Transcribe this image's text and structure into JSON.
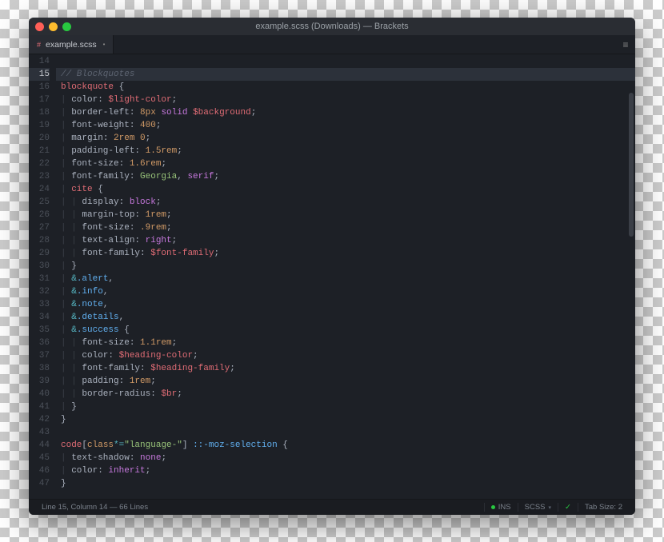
{
  "window": {
    "title": "example.scss (Downloads) — Brackets"
  },
  "tab": {
    "icon": "#",
    "label": "example.scss",
    "dirty": "•"
  },
  "menu_btn": "≡",
  "lines_start": 14,
  "lines_end": 47,
  "active_line": 15,
  "code": [
    {
      "n": 14,
      "h": ""
    },
    {
      "n": 15,
      "h": "<span class='cm'>// Blockquotes</span>"
    },
    {
      "n": 16,
      "h": "<span class='sel2'>blockquote</span> <span class='p'>{</span>"
    },
    {
      "n": 17,
      "h": "<span class='guide'>| </span><span class='prop'>color</span><span class='p'>: </span><span class='var'>$light-color</span><span class='p'>;</span>"
    },
    {
      "n": 18,
      "h": "<span class='guide'>| </span><span class='prop'>border-left</span><span class='p'>: </span><span class='num'>8px</span> <span class='kw'>solid</span> <span class='var'>$background</span><span class='p'>;</span>"
    },
    {
      "n": 19,
      "h": "<span class='guide'>| </span><span class='prop'>font-weight</span><span class='p'>: </span><span class='num'>400</span><span class='p'>;</span>"
    },
    {
      "n": 20,
      "h": "<span class='guide'>| </span><span class='prop'>margin</span><span class='p'>: </span><span class='num'>2rem</span> <span class='num'>0</span><span class='p'>;</span>"
    },
    {
      "n": 21,
      "h": "<span class='guide'>| </span><span class='prop'>padding-left</span><span class='p'>: </span><span class='num'>1.5rem</span><span class='p'>;</span>"
    },
    {
      "n": 22,
      "h": "<span class='guide'>| </span><span class='prop'>font-size</span><span class='p'>: </span><span class='num'>1.6rem</span><span class='p'>;</span>"
    },
    {
      "n": 23,
      "h": "<span class='guide'>| </span><span class='prop'>font-family</span><span class='p'>: </span><span class='str'>Georgia</span><span class='p'>, </span><span class='kw'>serif</span><span class='p'>;</span>"
    },
    {
      "n": 24,
      "h": "<span class='guide'>| </span><span class='sel2'>cite</span> <span class='p'>{</span>"
    },
    {
      "n": 25,
      "h": "<span class='guide'>| | </span><span class='prop'>display</span><span class='p'>: </span><span class='kw'>block</span><span class='p'>;</span>"
    },
    {
      "n": 26,
      "h": "<span class='guide'>| | </span><span class='prop'>margin-top</span><span class='p'>: </span><span class='num'>1rem</span><span class='p'>;</span>"
    },
    {
      "n": 27,
      "h": "<span class='guide'>| | </span><span class='prop'>font-size</span><span class='p'>: </span><span class='num'>.9rem</span><span class='p'>;</span>"
    },
    {
      "n": 28,
      "h": "<span class='guide'>| | </span><span class='prop'>text-align</span><span class='p'>: </span><span class='kw'>right</span><span class='p'>;</span>"
    },
    {
      "n": 29,
      "h": "<span class='guide'>| | </span><span class='prop'>font-family</span><span class='p'>: </span><span class='var'>$font-family</span><span class='p'>;</span>"
    },
    {
      "n": 30,
      "h": "<span class='guide'>| </span><span class='p'>}</span>"
    },
    {
      "n": 31,
      "h": "<span class='guide'>| </span><span class='op'>&amp;</span><span class='sel'>.alert</span><span class='p'>,</span>"
    },
    {
      "n": 32,
      "h": "<span class='guide'>| </span><span class='op'>&amp;</span><span class='sel'>.info</span><span class='p'>,</span>"
    },
    {
      "n": 33,
      "h": "<span class='guide'>| </span><span class='op'>&amp;</span><span class='sel'>.note</span><span class='p'>,</span>"
    },
    {
      "n": 34,
      "h": "<span class='guide'>| </span><span class='op'>&amp;</span><span class='sel'>.details</span><span class='p'>,</span>"
    },
    {
      "n": 35,
      "h": "<span class='guide'>| </span><span class='op'>&amp;</span><span class='sel'>.success</span> <span class='p'>{</span>"
    },
    {
      "n": 36,
      "h": "<span class='guide'>| | </span><span class='prop'>font-size</span><span class='p'>: </span><span class='num'>1.1rem</span><span class='p'>;</span>"
    },
    {
      "n": 37,
      "h": "<span class='guide'>| | </span><span class='prop'>color</span><span class='p'>: </span><span class='var'>$heading-color</span><span class='p'>;</span>"
    },
    {
      "n": 38,
      "h": "<span class='guide'>| | </span><span class='prop'>font-family</span><span class='p'>: </span><span class='var'>$heading-family</span><span class='p'>;</span>"
    },
    {
      "n": 39,
      "h": "<span class='guide'>| | </span><span class='prop'>padding</span><span class='p'>: </span><span class='num'>1rem</span><span class='p'>;</span>"
    },
    {
      "n": 40,
      "h": "<span class='guide'>| | </span><span class='prop'>border-radius</span><span class='p'>: </span><span class='var'>$br</span><span class='p'>;</span>"
    },
    {
      "n": 41,
      "h": "<span class='guide'>| </span><span class='p'>}</span>"
    },
    {
      "n": 42,
      "h": "<span class='p'>}</span>"
    },
    {
      "n": 43,
      "h": ""
    },
    {
      "n": 44,
      "h": "<span class='sel2'>code</span><span class='p'>[</span><span class='attr'>class</span><span class='op'>*=</span><span class='str'>\"language-\"</span><span class='p'>] </span><span class='sel'>::-moz-selection</span> <span class='p'>{</span>"
    },
    {
      "n": 45,
      "h": "<span class='guide'>| </span><span class='prop'>text-shadow</span><span class='p'>: </span><span class='kw'>none</span><span class='p'>;</span>"
    },
    {
      "n": 46,
      "h": "<span class='guide'>| </span><span class='prop'>color</span><span class='p'>: </span><span class='kw'>inherit</span><span class='p'>;</span>"
    },
    {
      "n": 47,
      "h": "<span class='p'>}</span>"
    }
  ],
  "status": {
    "left": "Line 15, Column 14 — 66 Lines",
    "ins": "INS",
    "lang": "SCSS",
    "tab": "Tab Size: 2",
    "chev": "▾"
  }
}
